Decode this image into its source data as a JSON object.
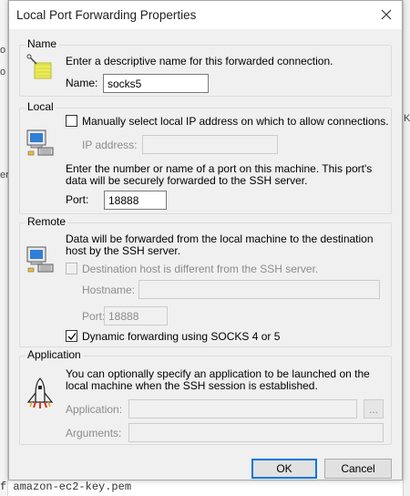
{
  "background": {
    "bottom_text": "f amazon-ec2-key.pem",
    "left_fragments": [
      "o",
      "o",
      "er"
    ],
    "right_fragments": [
      "K"
    ]
  },
  "dialog": {
    "title": "Local Port Forwarding Properties",
    "name_group": {
      "label": "Name",
      "description": "Enter a descriptive name for this forwarded connection.",
      "name_label": "Name:",
      "name_value": "socks5"
    },
    "local_group": {
      "label": "Local",
      "manual_ip_label": "Manually select local IP address on which to allow connections.",
      "manual_ip_checked": false,
      "ip_label": "IP address:",
      "ip_value": "",
      "port_description": "Enter the number or name of a port on this machine.  This port's data will be securely forwarded to the SSH server.",
      "port_label": "Port:",
      "port_value": "18888"
    },
    "remote_group": {
      "label": "Remote",
      "description": "Data will be forwarded from the local machine to the destination host by the SSH server.",
      "dest_diff_label": "Destination host is different from the SSH server.",
      "dest_diff_checked": false,
      "hostname_label": "Hostname:",
      "hostname_value": "",
      "port_label": "Port:",
      "port_value": "18888",
      "dynamic_label": "Dynamic forwarding using SOCKS 4 or 5",
      "dynamic_checked": true
    },
    "application_group": {
      "label": "Application",
      "description": "You can optionally specify an application to be launched on the local machine when the SSH session is established.",
      "application_label": "Application:",
      "application_value": "",
      "browse_label": "...",
      "arguments_label": "Arguments:",
      "arguments_value": ""
    },
    "buttons": {
      "ok": "OK",
      "cancel": "Cancel"
    }
  },
  "colors": {
    "dialog_bg": "#f0f0f0",
    "default_button_border": "#0078d7",
    "disabled_text": "#8c8c8c"
  },
  "icons": {
    "name_icon": "tag-icon",
    "local_icon": "computer-icon",
    "remote_icon": "computer-icon",
    "application_icon": "shuttle-icon",
    "close_icon": "close-icon",
    "check_icon": "check-icon"
  }
}
